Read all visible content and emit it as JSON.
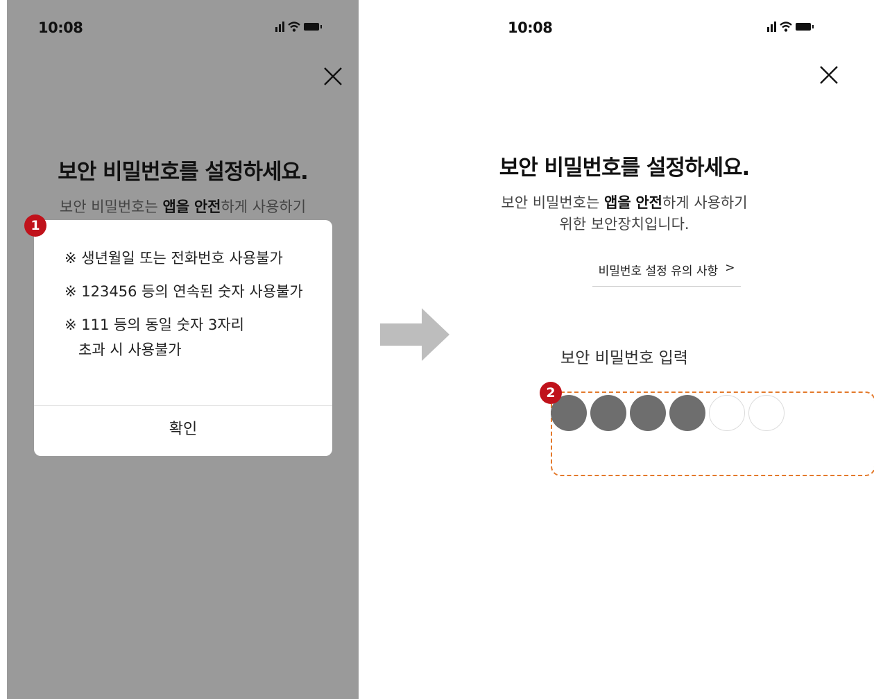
{
  "status_bar": {
    "time": "10:08"
  },
  "left_screen": {
    "title": "보안 비밀번호를 설정하세요.",
    "description_line1": {
      "before": "보안 비밀번호는 ",
      "bold1": "앱을",
      "space": " ",
      "bold2": "안전",
      "after": "하게 사용하기"
    },
    "badge": "1",
    "dialog": {
      "rules": [
        "※ 생년월일 또는 전화번호 사용불가",
        "※ 123456 등의 연속된 숫자 사용불가",
        "※ 111 등의 동일 숫자 3자리",
        "   초과 시 사용불가"
      ],
      "confirm_label": "확인"
    }
  },
  "right_screen": {
    "title": "보안 비밀번호를 설정하세요.",
    "description_line1": {
      "before": "보안 비밀번호는 ",
      "bold1": "앱을",
      "space": " ",
      "bold2": "안전",
      "after": "하게 사용하기"
    },
    "description_line2": "위한 보안장치입니다.",
    "guide_link": "비밀번호 설정 유의 사항",
    "guide_chevron": ">",
    "pin_label": "보안 비밀번호 입력",
    "badge": "2",
    "pin": {
      "length": 6,
      "entered": 4
    }
  },
  "icons": {
    "close": "close-icon",
    "signal": "signal-icon",
    "wifi": "wifi-icon",
    "battery": "battery-icon",
    "arrow": "arrow-right-icon"
  },
  "colors": {
    "overlay": "#9a9a9a",
    "badge": "#c0121b",
    "highlight_border": "#e3792b",
    "pin_filled": "#6e6e6e"
  }
}
